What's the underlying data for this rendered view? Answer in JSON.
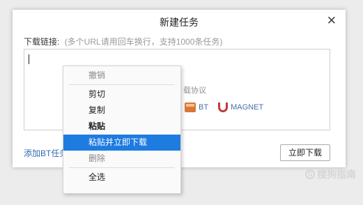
{
  "dialog": {
    "title": "新建任务",
    "close_icon": "close-icon",
    "download_label": "下载链接:",
    "download_hint": "(多个URL请用回车换行，支持1000条任务)",
    "supported_protocols": "载协议",
    "protocols": [
      {
        "label": "BT",
        "icon": "bt-file-icon"
      },
      {
        "label": "MAGNET",
        "icon": "magnet-icon"
      }
    ],
    "add_bt_task": "添加BT任务",
    "download_now_button": "立即下载"
  },
  "context_menu": {
    "items": [
      "撤销",
      "剪切",
      "复制",
      "粘贴",
      "粘贴并立即下载",
      "删除",
      "全选"
    ],
    "highlighted": "粘贴并立即下载",
    "highlight_color": "#1e7be0"
  },
  "watermark": {
    "text": "搜狗指南",
    "icon": "sogou-logo"
  }
}
